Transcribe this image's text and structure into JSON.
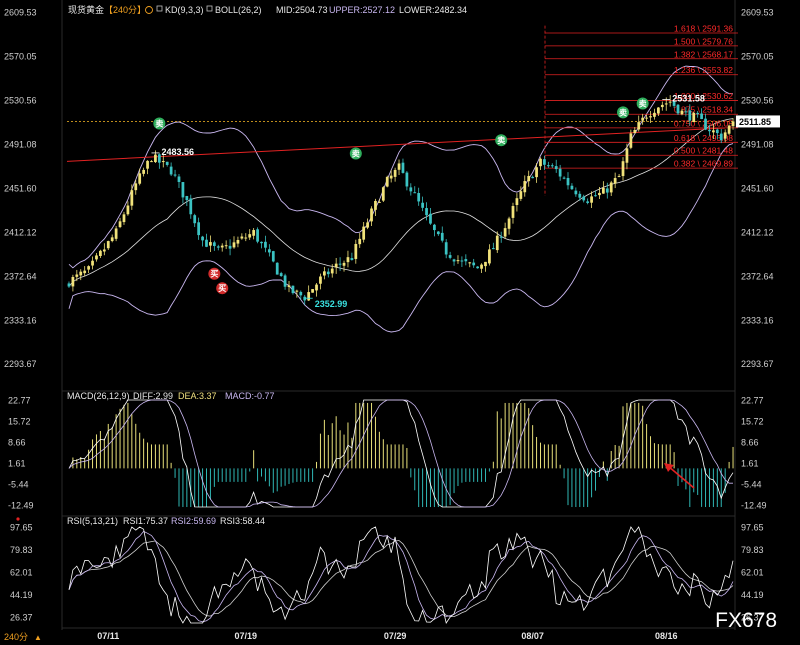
{
  "header": {
    "symbol": "现货黄金",
    "period": "【240分】",
    "indicators": [
      {
        "label": "KD(9,3,3)"
      },
      {
        "label": "BOLL(26,2)"
      },
      {
        "label": "MID:2504.73"
      },
      {
        "label": "UPPER:2527.12"
      },
      {
        "label": "LOWER:2482.34"
      }
    ]
  },
  "colors": {
    "up": "#f1e27a",
    "down": "#3bc3c3",
    "boll": "#c9b7f0",
    "red_line": "#e22222",
    "fib_label": "#ff2a2a",
    "macd_pos": "#e8e07a",
    "macd_neg": "#2fb7b5"
  },
  "chart_data": [
    {
      "type": "candlestick",
      "x_labels": [
        "07/11",
        "07/19",
        "07/29",
        "08/07",
        "08/16"
      ],
      "y_ticks": [
        2293.67,
        2333.16,
        2372.64,
        2412.12,
        2451.6,
        2491.08,
        2530.56,
        2570.05,
        2609.53
      ],
      "ylim": [
        2275,
        2612
      ],
      "current_price": 2511.85,
      "annotations": [
        {
          "text": "2483.56",
          "price": 2483.56
        },
        {
          "text": "2352.99",
          "price": 2352.99
        },
        {
          "text": "2531.58",
          "price": 2531.58
        }
      ],
      "signals": [
        {
          "text": "卖"
        },
        {
          "text": "买"
        },
        {
          "text": "买"
        },
        {
          "text": "卖"
        },
        {
          "text": "卖"
        },
        {
          "text": "卖"
        },
        {
          "text": "卖"
        }
      ],
      "fib_levels": [
        {
          "ratio": "1.618",
          "price": 2591.36,
          "label": "1.618 \\ 2591.36"
        },
        {
          "ratio": "1.500",
          "price": 2579.76,
          "label": "1.500 \\ 2579.76"
        },
        {
          "ratio": "1.382",
          "price": 2568.17,
          "label": "1.382 \\ 2568.17"
        },
        {
          "ratio": "1.236",
          "price": 2553.82,
          "label": "1.236 \\ 2553.82"
        },
        {
          "ratio": "1.000",
          "price": 2530.62,
          "label": "1.000 \\ 2530.62"
        },
        {
          "ratio": "0.875",
          "price": 2518.34,
          "label": "0.875 \\ 2518.34"
        },
        {
          "ratio": "0.750",
          "price": 2506.05,
          "label": "0.750 \\ 2506.05"
        },
        {
          "ratio": "0.618",
          "price": 2493.08,
          "label": "0.618 \\ 2493.08"
        },
        {
          "ratio": "0.500",
          "price": 2481.48,
          "label": "0.500 \\ 2481.48"
        },
        {
          "ratio": "0.382",
          "price": 2469.89,
          "label": "0.382 \\ 2469.89"
        }
      ]
    },
    {
      "type": "bar",
      "name": "MACD",
      "header": {
        "title": "MACD(26,12,9)",
        "diff": "DIFF:2.99",
        "dea": "DEA:3.37",
        "macd": "MACD:-0.77"
      },
      "y_ticks": [
        22.77,
        15.72,
        8.66,
        1.61,
        -5.44,
        -12.49
      ],
      "ylim": [
        -14,
        24
      ]
    },
    {
      "type": "line",
      "name": "RSI",
      "header": {
        "title": "RSI(5,13,21)",
        "rsi1": "RSI1:75.37",
        "rsi2": "RSI2:59.69",
        "rsi3": "RSI3:58.44"
      },
      "y_ticks": [
        97.65,
        79.83,
        62.01,
        44.19,
        26.37
      ],
      "ylim": [
        18,
        102
      ]
    }
  ],
  "footer": {
    "period_button": "240分",
    "arrow": "▲"
  },
  "watermark": "FX678"
}
